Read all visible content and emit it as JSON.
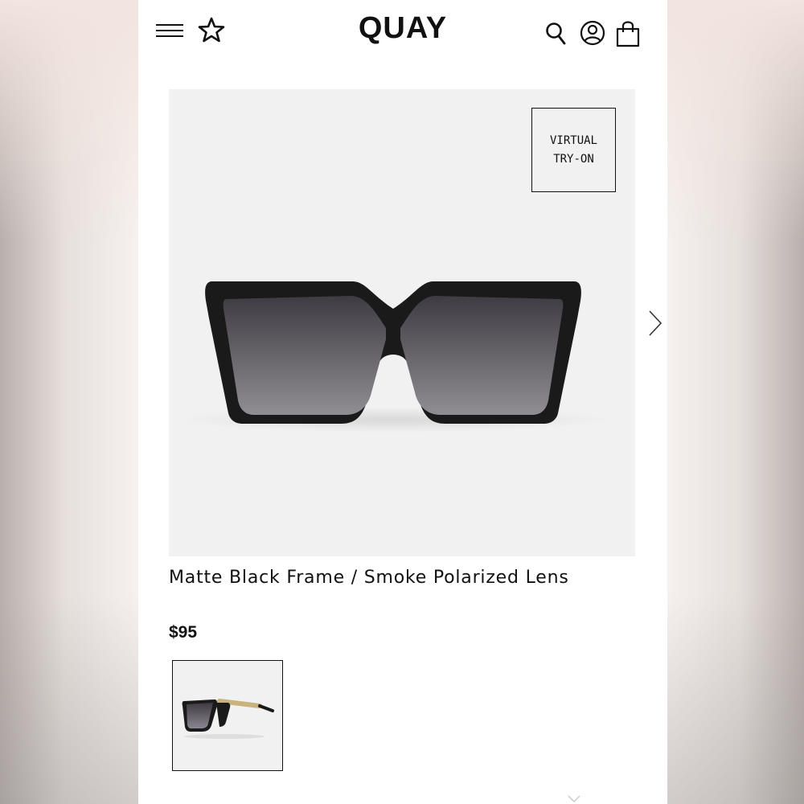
{
  "header": {
    "logo": "QUAY",
    "icons": [
      "menu-icon",
      "star-icon",
      "search-icon",
      "account-icon",
      "bag-icon"
    ]
  },
  "gallery": {
    "virtual_try_on_line1": "VIRTUAL",
    "virtual_try_on_line2": "TRY-ON",
    "next_icon": "chevron-right-icon"
  },
  "product": {
    "title": "Matte Black Frame / Smoke Polarized Lens",
    "price": "$95"
  },
  "colors": {
    "text": "#111111",
    "image_background": "#f1f1f1",
    "frame": "#1a1a1a",
    "lens_top": "#3e3b42",
    "lens_bottom": "#8e8b91",
    "temple_gold": "#c9b27c"
  }
}
